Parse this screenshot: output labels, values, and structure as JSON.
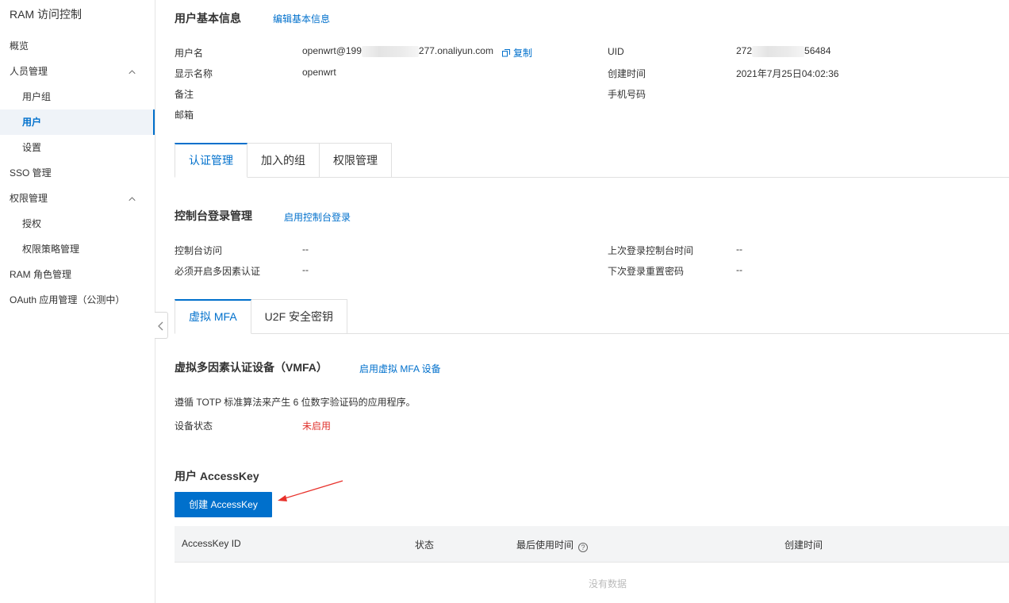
{
  "sidebar": {
    "title": "RAM 访问控制",
    "items": [
      {
        "label": "概览"
      },
      {
        "label": "人员管理"
      },
      {
        "label": "用户组"
      },
      {
        "label": "用户"
      },
      {
        "label": "设置"
      },
      {
        "label": "SSO 管理"
      },
      {
        "label": "权限管理"
      },
      {
        "label": "授权"
      },
      {
        "label": "权限策略管理"
      },
      {
        "label": "RAM 角色管理"
      },
      {
        "label": "OAuth 应用管理（公测中）"
      }
    ]
  },
  "basic": {
    "title": "用户基本信息",
    "edit_link": "编辑基本信息",
    "username_label": "用户名",
    "username_prefix": "openwrt@199",
    "username_suffix": "277.onaliyun.com",
    "copy_label": "复制",
    "display_label": "显示名称",
    "display_value": "openwrt",
    "note_label": "备注",
    "email_label": "邮箱",
    "uid_label": "UID",
    "uid_prefix": "272",
    "uid_suffix": "56484",
    "created_label": "创建时间",
    "created_value": "2021年7月25日04:02:36",
    "phone_label": "手机号码"
  },
  "main_tabs": [
    "认证管理",
    "加入的组",
    "权限管理"
  ],
  "console": {
    "title": "控制台登录管理",
    "enable_link": "启用控制台登录",
    "access_label": "控制台访问",
    "access_value": "--",
    "mfa_label": "必须开启多因素认证",
    "mfa_value": "--",
    "last_login_label": "上次登录控制台时间",
    "last_login_value": "--",
    "reset_label": "下次登录重置密码",
    "reset_value": "--"
  },
  "mfa_tabs": [
    "虚拟 MFA",
    "U2F 安全密钥"
  ],
  "vmfa": {
    "title": "虚拟多因素认证设备（VMFA）",
    "enable_link": "启用虚拟 MFA 设备",
    "desc": "遵循 TOTP 标准算法来产生 6 位数字验证码的应用程序。",
    "status_label": "设备状态",
    "status_value": "未启用"
  },
  "accesskey": {
    "title": "用户 AccessKey",
    "create_button": "创建 AccessKey",
    "columns": [
      "AccessKey ID",
      "状态",
      "最后使用时间",
      "创建时间"
    ],
    "help_icon": "?",
    "empty_text": "没有数据"
  },
  "colors": {
    "accent": "#0070cc",
    "danger": "#e0342f",
    "annotation_arrow": "#e8312b"
  }
}
